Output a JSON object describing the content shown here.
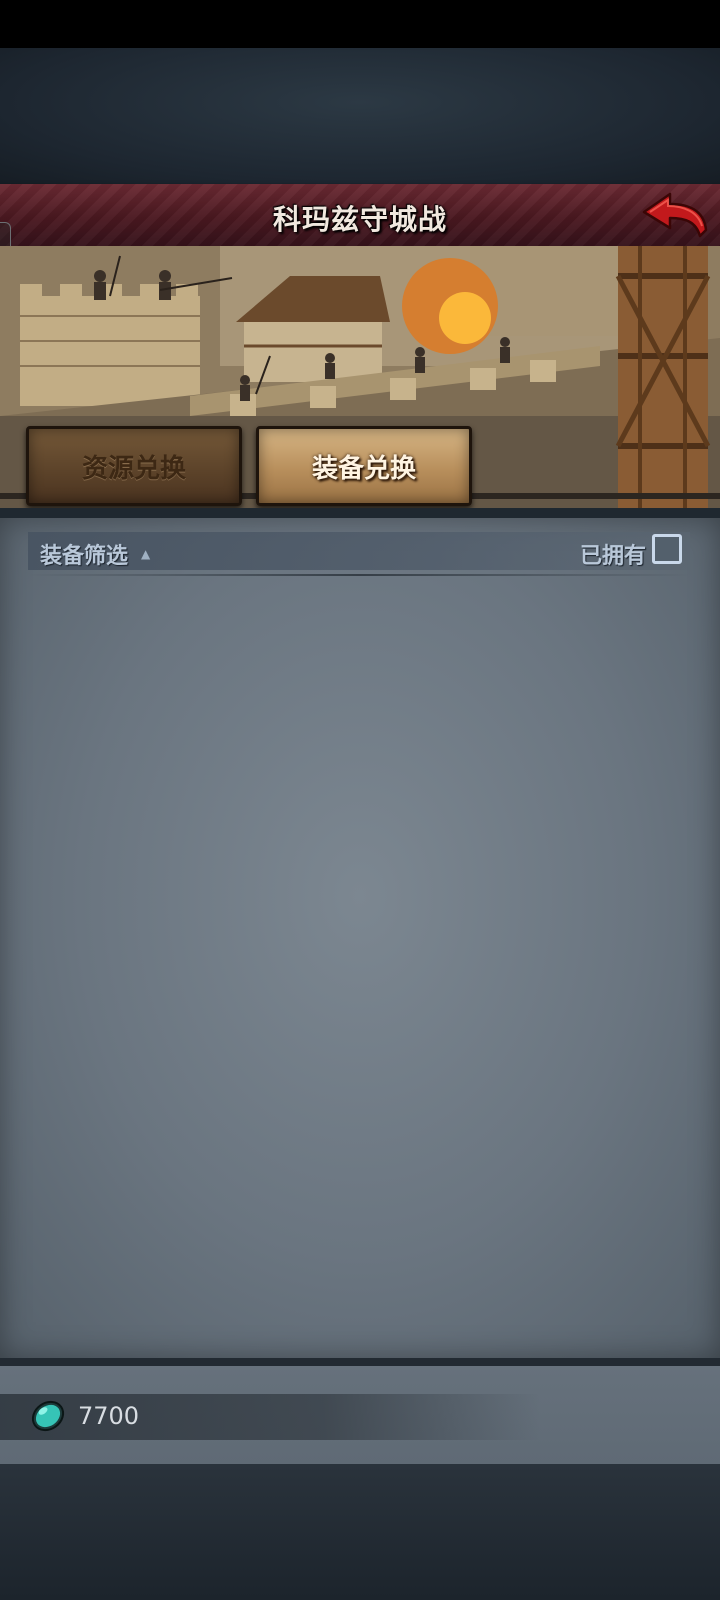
{
  "header": {
    "title": "科玛兹守城战",
    "back_icon": "back-arrow-icon"
  },
  "tabs": [
    {
      "label": "资源兑换",
      "active": false
    },
    {
      "label": "装备兑换",
      "active": true
    }
  ],
  "filter": {
    "label": "装备筛选",
    "sort_indicator": "▲",
    "owned_label": "已拥有",
    "owned_checked": false
  },
  "currency": {
    "icon": "gem-icon",
    "amount": "7700"
  },
  "colors": {
    "header_accent": "#5a1f27",
    "active_tab": "#c9a26e",
    "inactive_tab": "#5b4229",
    "panel": "#6f7a85",
    "gem": "#3fd0c2"
  }
}
